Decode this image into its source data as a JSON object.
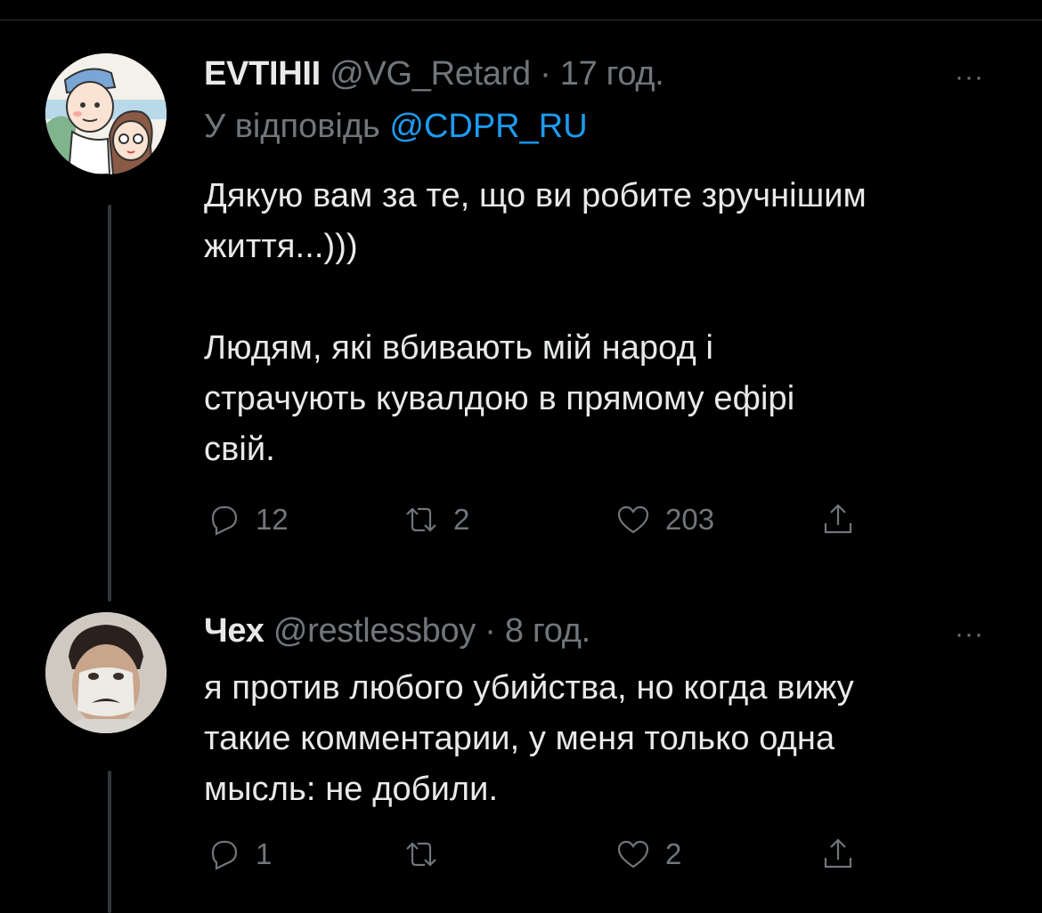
{
  "tweets": [
    {
      "name": "EVTIHII",
      "handle": "@VG_Retard",
      "separator": "·",
      "time": "17 год.",
      "more": "···",
      "reply_prefix": "У відповідь ",
      "reply_to": "@CDPR_RU",
      "text": "Дякую вам за те, що ви робите зручнішим\nжиття...)))\n\nЛюдям, які вбивають мій народ і\nстрачують кувалдою в прямому ефірі\nсвій.",
      "counts": {
        "reply": "12",
        "retweet": "2",
        "like": "203"
      },
      "icons": [
        "reply-icon",
        "retweet-icon",
        "like-icon",
        "share-icon"
      ]
    },
    {
      "name": "Чех",
      "handle": "@restlessboy",
      "separator": "·",
      "time": "8 год.",
      "more": "···",
      "text": "я против любого убийства, но когда вижу\nтакие комментарии, у меня только одна\nмысль: не добили.",
      "counts": {
        "reply": "1",
        "retweet": "",
        "like": "2"
      },
      "icons": [
        "reply-icon",
        "retweet-icon",
        "like-icon",
        "share-icon"
      ]
    }
  ],
  "colors": {
    "background": "#000000",
    "text": "#e7e9ea",
    "muted": "#71767b",
    "link": "#1d9bf0"
  }
}
